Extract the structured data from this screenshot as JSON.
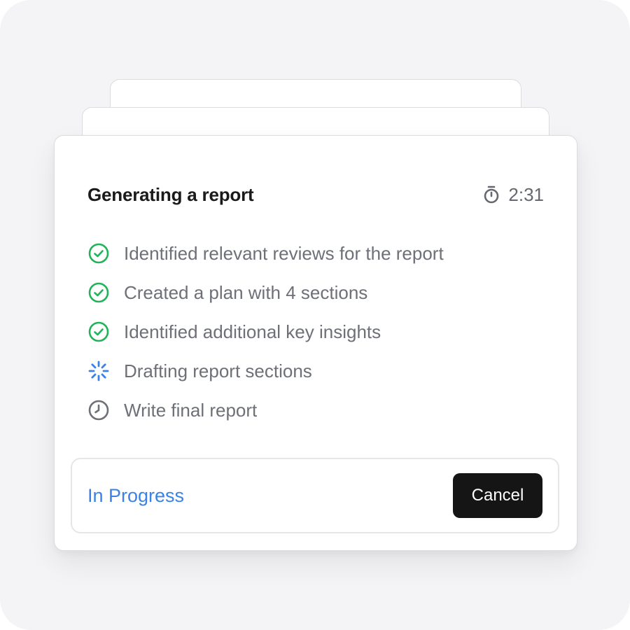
{
  "card": {
    "title": "Generating a report",
    "timer": {
      "icon": "stopwatch-icon",
      "value": "2:31"
    }
  },
  "steps": [
    {
      "label": "Identified relevant reviews for the report",
      "status": "completed",
      "icon": "check-circle-icon"
    },
    {
      "label": "Created a plan with 4 sections",
      "status": "completed",
      "icon": "check-circle-icon"
    },
    {
      "label": "Identified additional key insights",
      "status": "completed",
      "icon": "check-circle-icon"
    },
    {
      "label": "Drafting report sections",
      "status": "in-progress",
      "icon": "spinner-icon"
    },
    {
      "label": "Write final report",
      "status": "pending",
      "icon": "clock-icon"
    }
  ],
  "footer": {
    "status_label": "In Progress",
    "cancel_label": "Cancel"
  },
  "colors": {
    "completed": "#22b35a",
    "in_progress": "#3b82e6",
    "pending": "#6e7078",
    "title": "#1a1a1a",
    "button_bg": "#151515"
  }
}
